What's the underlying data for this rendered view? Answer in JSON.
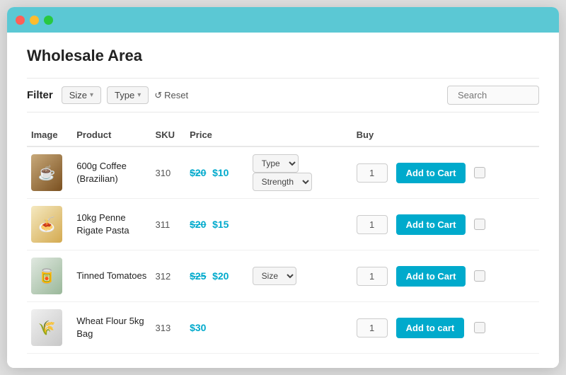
{
  "window": {
    "title": "Wholesale Area"
  },
  "filter": {
    "label": "Filter",
    "size_btn": "Size",
    "type_btn": "Type",
    "reset_btn": "Reset",
    "search_placeholder": "Search"
  },
  "table": {
    "headers": {
      "image": "Image",
      "product": "Product",
      "sku": "SKU",
      "price": "Price",
      "buy": "Buy"
    },
    "rows": [
      {
        "id": 1,
        "image_icon": "☕",
        "image_bg": "#c8a97a",
        "product": "600g Coffee (Brazilian)",
        "sku": "310",
        "price_old": "$20",
        "price_new": "$10",
        "has_options": true,
        "option1": "Type",
        "option2": "Strength",
        "qty": "1",
        "action": "Add to Cart"
      },
      {
        "id": 2,
        "image_icon": "🍝",
        "image_bg": "#f5e9c0",
        "product": "10kg Penne Rigate Pasta",
        "sku": "311",
        "price_old": "$20",
        "price_new": "$15",
        "has_options": false,
        "option1": null,
        "option2": null,
        "qty": "1",
        "action": "Add to Cart"
      },
      {
        "id": 3,
        "image_icon": "🥫",
        "image_bg": "#e8e8e8",
        "product": "Tinned Tomatoes",
        "sku": "312",
        "price_old": "$25",
        "price_new": "$20",
        "has_options": true,
        "option1": "Size",
        "option2": null,
        "qty": "1",
        "action": "Add to Cart"
      },
      {
        "id": 4,
        "image_icon": "🌾",
        "image_bg": "#f0f0f0",
        "product": "Wheat Flour 5kg Bag",
        "sku": "313",
        "price_single": "$30",
        "has_options": false,
        "option1": null,
        "option2": null,
        "qty": "1",
        "action": "Add to cart"
      }
    ]
  }
}
